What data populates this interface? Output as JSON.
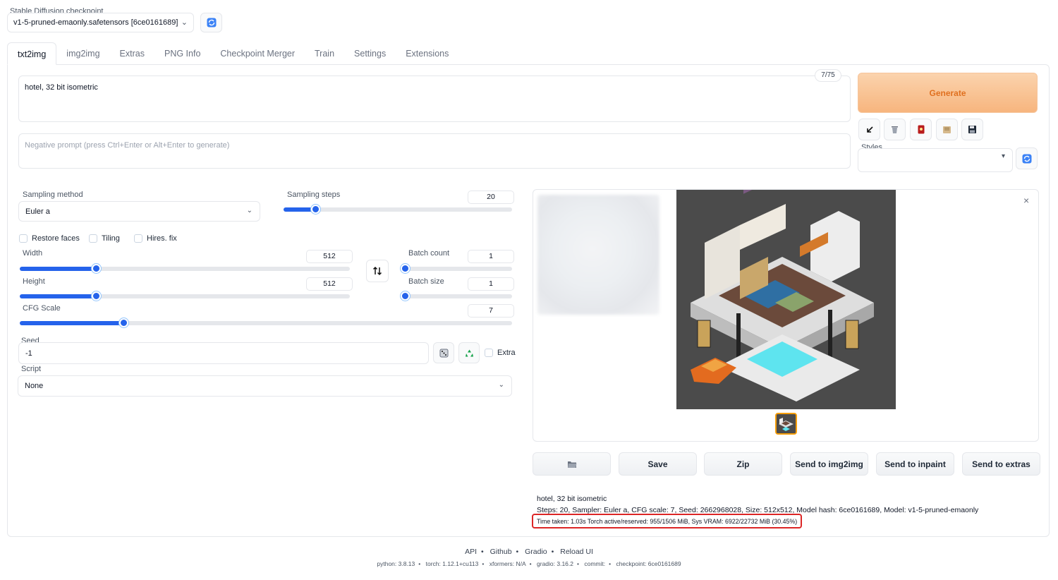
{
  "checkpoint": {
    "label": "Stable Diffusion checkpoint",
    "value": "v1-5-pruned-emaonly.safetensors [6ce0161689]"
  },
  "tabs": [
    "txt2img",
    "img2img",
    "Extras",
    "PNG Info",
    "Checkpoint Merger",
    "Train",
    "Settings",
    "Extensions"
  ],
  "prompt": {
    "value": "hotel, 32 bit isometric",
    "token_counter": "7/75",
    "negative_placeholder": "Negative prompt (press Ctrl+Enter or Alt+Enter to generate)"
  },
  "generate_label": "Generate",
  "toolbar_icons": [
    "arrow-down-left-icon",
    "trash-icon",
    "card-icon",
    "clipboard-icon",
    "floppy-disk-icon"
  ],
  "styles": {
    "label": "Styles",
    "value": ""
  },
  "sampling": {
    "method_label": "Sampling method",
    "method_value": "Euler a",
    "steps_label": "Sampling steps",
    "steps_value": "20",
    "steps_fraction": 0.14
  },
  "checkboxes": {
    "restore_faces": "Restore faces",
    "tiling": "Tiling",
    "hires_fix": "Hires. fix",
    "extra": "Extra"
  },
  "width": {
    "label": "Width",
    "value": "512",
    "fraction": 0.23
  },
  "height": {
    "label": "Height",
    "value": "512",
    "fraction": 0.23
  },
  "batch_count": {
    "label": "Batch count",
    "value": "1",
    "fraction": 0.0
  },
  "batch_size": {
    "label": "Batch size",
    "value": "1",
    "fraction": 0.0
  },
  "cfg_scale": {
    "label": "CFG Scale",
    "value": "7",
    "fraction": 0.21
  },
  "seed": {
    "label": "Seed",
    "value": "-1"
  },
  "script": {
    "label": "Script",
    "value": "None"
  },
  "output_buttons": {
    "folder": "",
    "save": "Save",
    "zip": "Zip",
    "send_img2img": "Send to img2img",
    "send_inpaint": "Send to inpaint",
    "send_extras": "Send to extras"
  },
  "info": {
    "prompt": "hotel, 32 bit isometric",
    "params": "Steps: 20, Sampler: Euler a, CFG scale: 7, Seed: 2662968028, Size: 512x512, Model hash: 6ce0161689, Model: v1-5-pruned-emaonly",
    "time": "Time taken: 1.03s  Torch active/reserved: 955/1506 MiB, Sys VRAM: 6922/22732 MiB (30.45%)"
  },
  "footer": {
    "links": [
      "API",
      "Github",
      "Gradio",
      "Reload UI"
    ],
    "versions": [
      "python: 3.8.13",
      "torch: 1.12.1+cu113",
      "xformers: N/A",
      "gradio: 3.16.2",
      "commit:",
      "checkpoint: 6ce0161689"
    ]
  },
  "colors": {
    "accent": "#2563eb",
    "generate_text": "#e0701f",
    "highlight": "#dc2626"
  }
}
